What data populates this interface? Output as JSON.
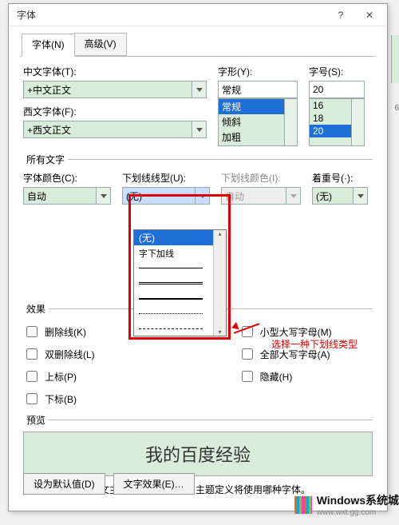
{
  "dialog": {
    "title": "字体",
    "help_title": "帮助",
    "close_title": "关闭"
  },
  "tabs": {
    "font": "字体(N)",
    "advanced": "高级(V)"
  },
  "labels": {
    "chinese_font": "中文字体(T):",
    "western_font": "西文字体(F):",
    "style": "字形(Y):",
    "size": "字号(S):",
    "all_text": "所有文字",
    "font_color": "字体颜色(C):",
    "underline_style": "下划线线型(U):",
    "underline_color": "下划线颜色(I):",
    "emphasis": "着重号(·):",
    "effects": "效果",
    "preview": "预览"
  },
  "values": {
    "chinese_font": "+中文正文",
    "western_font": "+西文正文",
    "style": "常规",
    "size": "20",
    "font_color": "自动",
    "underline_style": "(无)",
    "underline_color": "自动",
    "emphasis": "(无)"
  },
  "style_options": [
    "常规",
    "倾斜",
    "加粗"
  ],
  "style_selected_index": 0,
  "size_options": [
    "16",
    "18",
    "20"
  ],
  "size_selected_index": 2,
  "underline_dropdown": {
    "text_options": [
      "(无)",
      "字下加线"
    ],
    "selected_text_index": 0,
    "line_styles": [
      "solid",
      "double",
      "thick",
      "dot",
      "dash"
    ]
  },
  "checks": {
    "left": [
      {
        "label": "删除线(K)"
      },
      {
        "label": "双删除线(L)"
      },
      {
        "label": "上标(P)"
      },
      {
        "label": "下标(B)"
      }
    ],
    "right": [
      {
        "label": "小型大写字母(M)"
      },
      {
        "label": "全部大写字母(A)"
      },
      {
        "label": "隐藏(H)"
      }
    ]
  },
  "preview_text": "我的百度经验",
  "description": "这是用于中文的正文主题字体。当前文档主题定义将使用哪种字体。",
  "buttons": {
    "default": "设为默认值(D)",
    "text_effects": "文字效果(E)…"
  },
  "hint": "选择一种下划线类型",
  "watermark": {
    "line1": "Windows系统城",
    "line2": "www.wxt.gg.com"
  },
  "edge_number": "6"
}
